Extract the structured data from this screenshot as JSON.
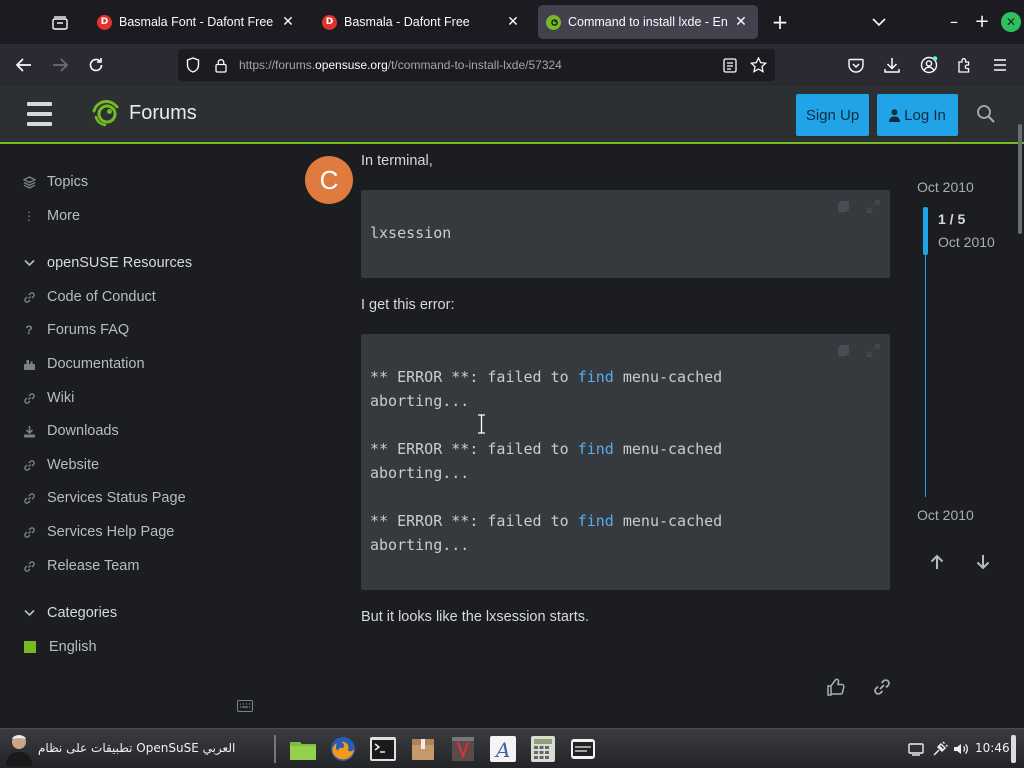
{
  "browser": {
    "tabs": [
      {
        "title": "Basmala Font - Dafont Free",
        "favicon": "D",
        "active": false
      },
      {
        "title": "Basmala - Dafont Free",
        "favicon": "D",
        "active": false
      },
      {
        "title": "Command to install lxde - English",
        "favicon": "",
        "active": true
      }
    ],
    "url": {
      "prefix": "https://forums.",
      "domain": "opensuse.org",
      "path": "/t/command-to-install-lxde/57324"
    }
  },
  "forum": {
    "brand": "Forums",
    "signup_label": "Sign Up",
    "login_label": "Log In",
    "accent": "#73ba25",
    "button_color": "#21a4e7"
  },
  "sidebar": {
    "top": [
      {
        "label": "Topics",
        "icon": "layers-icon"
      },
      {
        "label": "More",
        "icon": "vertical-ellipsis-icon"
      }
    ],
    "resources_title": "openSUSE Resources",
    "resources": [
      {
        "label": "Code of Conduct",
        "icon": "link-icon"
      },
      {
        "label": "Forums FAQ",
        "icon": "question-icon"
      },
      {
        "label": "Documentation",
        "icon": "tools-icon"
      },
      {
        "label": "Wiki",
        "icon": "link-icon"
      },
      {
        "label": "Downloads",
        "icon": "download-icon"
      },
      {
        "label": "Website",
        "icon": "link-icon"
      },
      {
        "label": "Services Status Page",
        "icon": "link-icon"
      },
      {
        "label": "Services Help Page",
        "icon": "link-icon"
      },
      {
        "label": "Release Team",
        "icon": "link-icon"
      }
    ],
    "categories_title": "Categories",
    "categories": [
      {
        "label": "English",
        "color": "#73ba25"
      }
    ]
  },
  "post": {
    "avatar_letter": "C",
    "intro": "In terminal,",
    "command": "lxsession",
    "error_intro": "I get this error:",
    "error_lines": [
      {
        "pre": "** ERROR **: failed to ",
        "kw": "find",
        "post": " menu-cached",
        "next": "aborting..."
      },
      {
        "pre": "** ERROR **: failed to ",
        "kw": "find",
        "post": " menu-cached",
        "next": "aborting..."
      },
      {
        "pre": "** ERROR **: failed to ",
        "kw": "find",
        "post": " menu-cached",
        "next": "aborting..."
      }
    ],
    "outro": "But it looks like the lxsession starts."
  },
  "timeline": {
    "start_date": "Oct 2010",
    "position": "1 / 5",
    "position_date": "Oct 2010",
    "end_date": "Oct 2010"
  },
  "taskbar": {
    "label": "تطبيقات على نظام OpenSuSE العربي",
    "clock": "10:46",
    "apps": [
      "file-manager-icon",
      "firefox-icon",
      "terminal-icon",
      "archive-icon",
      "office-icon",
      "font-viewer-icon",
      "calculator-icon",
      "screenshot-icon"
    ]
  }
}
